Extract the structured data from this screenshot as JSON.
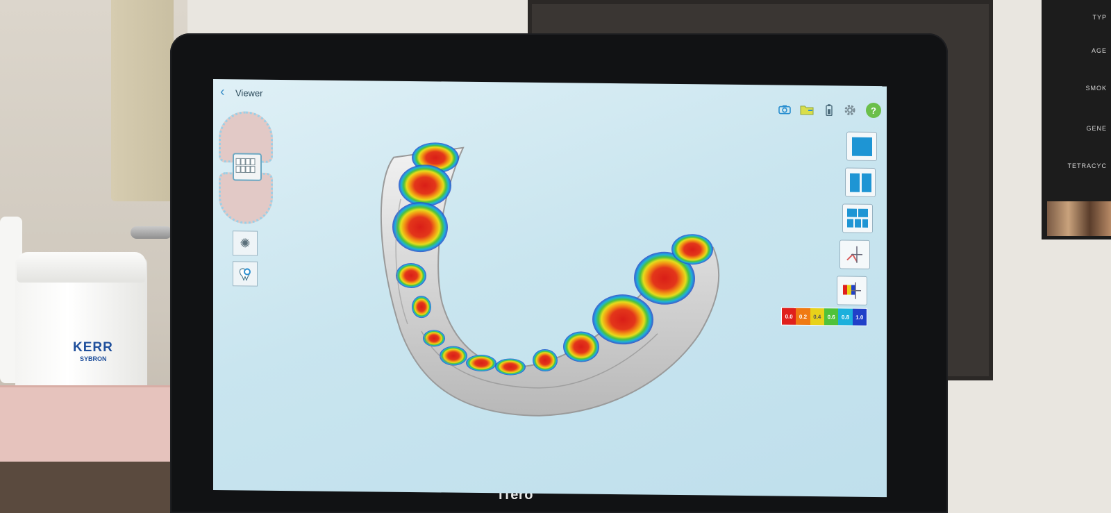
{
  "app": {
    "title": "Viewer",
    "brand": "iTero"
  },
  "toolbar": {
    "icons": [
      "camera-icon",
      "folder-icon",
      "battery-icon",
      "gear-icon",
      "help-icon"
    ],
    "help_label": "?"
  },
  "left_panel": {
    "tools": [
      "sparkle-icon",
      "tooth-zoom-icon"
    ]
  },
  "view_layouts": [
    "single-view",
    "dual-view",
    "quad-view",
    "occlusion-view",
    "occlusion-map-view"
  ],
  "legend": {
    "labels": [
      "0.0",
      "0.2",
      "0.4",
      "0.6",
      "0.8",
      "1.0"
    ],
    "colors": [
      "#e0201c",
      "#f07a12",
      "#e8d21a",
      "#4fc23a",
      "#1cb0dc",
      "#2040c8"
    ]
  },
  "jar": {
    "brand": "KERR",
    "sub": "SYBRON"
  },
  "colors": {
    "accent": "#1e95d4",
    "screen_bg": "#c9e5ef",
    "help_green": "#6bbf4a"
  }
}
